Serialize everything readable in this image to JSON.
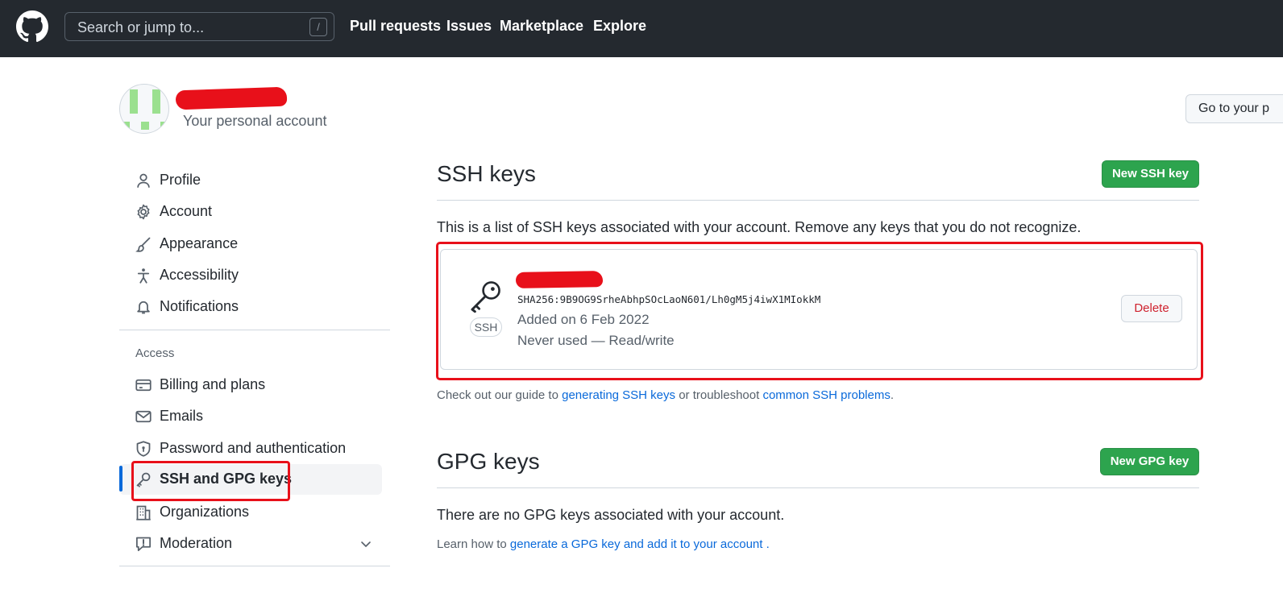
{
  "header": {
    "search_placeholder": "Search or jump to...",
    "search_shortcut": "/",
    "nav": [
      "Pull requests",
      "Issues",
      "Marketplace",
      "Explore"
    ]
  },
  "account": {
    "subtitle": "Your personal account",
    "goto_button": "Go to your p"
  },
  "sidebar": {
    "items": [
      {
        "label": "Profile",
        "icon": "person-icon"
      },
      {
        "label": "Account",
        "icon": "gear-icon"
      },
      {
        "label": "Appearance",
        "icon": "paintbrush-icon"
      },
      {
        "label": "Accessibility",
        "icon": "accessibility-icon"
      },
      {
        "label": "Notifications",
        "icon": "bell-icon"
      }
    ],
    "access_heading": "Access",
    "access_items": [
      {
        "label": "Billing and plans",
        "icon": "credit-card-icon"
      },
      {
        "label": "Emails",
        "icon": "mail-icon"
      },
      {
        "label": "Password and authentication",
        "icon": "shield-lock-icon"
      },
      {
        "label": "SSH and GPG keys",
        "icon": "key-icon",
        "active": true
      },
      {
        "label": "Organizations",
        "icon": "organization-icon"
      },
      {
        "label": "Moderation",
        "icon": "report-icon"
      }
    ]
  },
  "ssh": {
    "title": "SSH keys",
    "new_button": "New SSH key",
    "description": "This is a list of SSH keys associated with your account. Remove any keys that you do not recognize.",
    "key": {
      "badge": "SSH",
      "fingerprint": "SHA256:9B9OG9SrheAbhpSOcLaoN601/Lh0gM5j4iwX1MIokkM",
      "added": "Added on 6 Feb 2022",
      "usage": "Never used — Read/write",
      "delete_label": "Delete"
    },
    "guide_prefix": "Check out our guide to",
    "guide_link": "generating SSH keys",
    "guide_middle": "or troubleshoot",
    "guide_link2": "common SSH problems",
    "guide_suffix": "."
  },
  "gpg": {
    "title": "GPG keys",
    "new_button": "New GPG key",
    "empty": "There are no GPG keys associated with your account.",
    "learn_prefix": "Learn how to",
    "learn_link": "generate a GPG key and add it to your account",
    "learn_suffix": "."
  },
  "colors": {
    "header_bg": "#24292f",
    "primary_green": "#2da44e",
    "link_blue": "#0969da",
    "danger_red": "#cf222e",
    "annotation_red": "#e8101a"
  }
}
